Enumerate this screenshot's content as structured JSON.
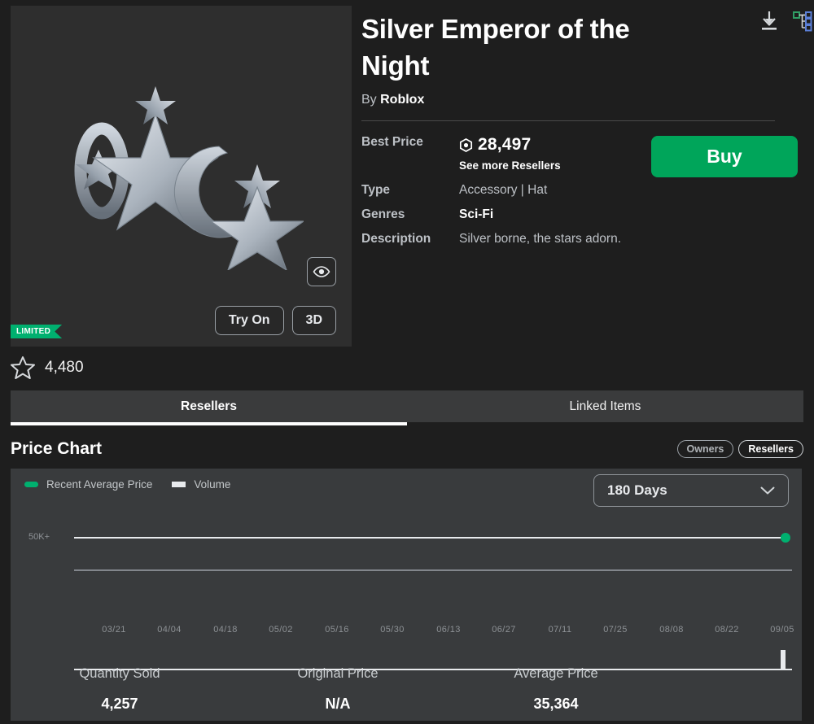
{
  "item": {
    "title": "Silver Emperor of the Night",
    "by_prefix": "By",
    "creator": "Roblox",
    "limited_badge": "LIMITED",
    "favorites": "4,480",
    "try_on_label": "Try On",
    "three_d_label": "3D"
  },
  "details": {
    "best_price_label": "Best Price",
    "best_price_value": "28,497",
    "see_more_label": "See more Resellers",
    "type_label": "Type",
    "type_value": "Accessory | Hat",
    "genres_label": "Genres",
    "genres_value": "Sci-Fi",
    "description_label": "Description",
    "description_value": "Silver borne, the stars adorn.",
    "buy_label": "Buy"
  },
  "tabs": [
    {
      "label": "Resellers",
      "active": true
    },
    {
      "label": "Linked Items",
      "active": false
    }
  ],
  "chart_header": {
    "title": "Price Chart",
    "owners_toggle": "Owners",
    "resellers_toggle": "Resellers"
  },
  "chart_controls": {
    "range_value": "180 Days",
    "chevron": "chevron-down"
  },
  "stats": [
    {
      "label": "Quantity Sold",
      "value": "4,257"
    },
    {
      "label": "Original Price",
      "value": "N/A"
    },
    {
      "label": "Average Price",
      "value": "35,364"
    }
  ],
  "colors": {
    "accent_green": "#00b06f",
    "buy_green": "#00a55a",
    "page_bg": "#1e1e1e",
    "card_bg": "#393b3d",
    "volume_white": "#e8eaed"
  },
  "chart_data": {
    "type": "line",
    "title": "Price Chart",
    "xlabel": "",
    "ylabel": "",
    "grid": false,
    "legend_position": "top-left",
    "yticks": [
      "50K+"
    ],
    "ylim": [
      0,
      50000
    ],
    "x": [
      "03/21",
      "04/04",
      "04/18",
      "05/02",
      "05/16",
      "05/30",
      "06/13",
      "06/27",
      "07/11",
      "07/25",
      "08/08",
      "08/22",
      "09/05"
    ],
    "series": [
      {
        "name": "Recent Average Price",
        "color": "#00b06f",
        "type": "line",
        "values": [
          50000,
          50000,
          50000,
          50000,
          50000,
          50000,
          50000,
          50000,
          50000,
          50000,
          50000,
          50000,
          50000
        ],
        "end_marker": true
      },
      {
        "name": "Volume",
        "color": "#e8eaed",
        "type": "bar",
        "values": [
          0,
          0,
          0,
          0,
          0,
          0,
          0,
          0,
          0,
          0,
          0,
          0,
          1
        ]
      }
    ]
  }
}
